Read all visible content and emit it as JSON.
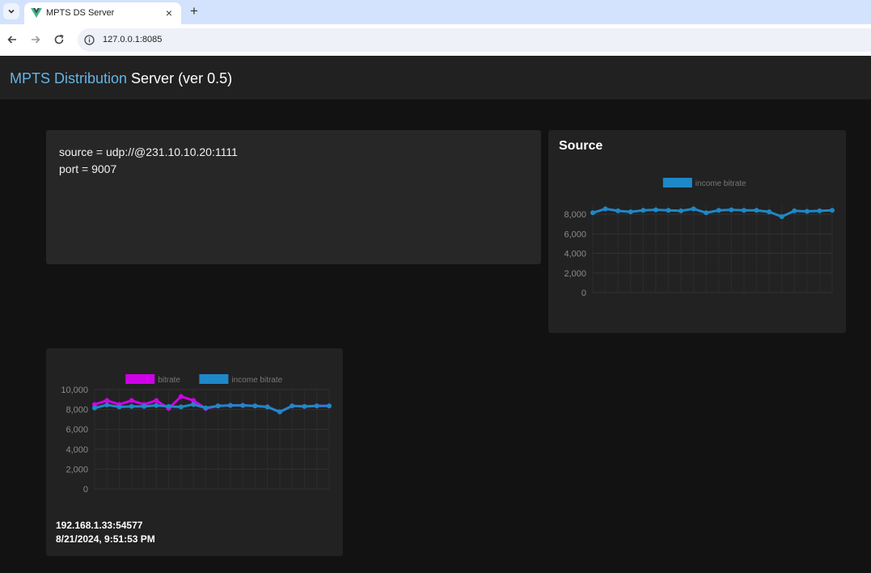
{
  "browser": {
    "tab_title": "MPTS DS Server",
    "url": "127.0.0.1:8085"
  },
  "app": {
    "title_accent": "MPTS Distribution",
    "title_rest": " Server (ver 0.5)"
  },
  "info": {
    "source_line": "source = udp://@231.10.10.20:1111",
    "port_line": "port = 9007"
  },
  "source_card": {
    "title": "Source"
  },
  "client_card": {
    "address": "192.168.1.33:54577",
    "timestamp": "8/21/2024, 9:51:53 PM"
  },
  "colors": {
    "income": "#1e88c8",
    "bitrate": "#d000e8",
    "accent": "#64b5e6"
  },
  "chart_data": [
    {
      "type": "line",
      "legend": "top",
      "grid": true,
      "ylim": [
        0,
        9000
      ],
      "yticks": [
        0,
        2000,
        4000,
        6000,
        8000
      ],
      "ytick_labels": [
        "0",
        "2,000",
        "4,000",
        "6,000",
        "8,000"
      ],
      "series": [
        {
          "name": "income bitrate",
          "color": "#1e88c8",
          "values": [
            8150,
            8550,
            8350,
            8250,
            8400,
            8450,
            8400,
            8350,
            8550,
            8150,
            8400,
            8450,
            8400,
            8400,
            8250,
            7750,
            8350,
            8300,
            8350,
            8400
          ]
        }
      ]
    },
    {
      "type": "line",
      "legend": "top",
      "grid": true,
      "ylim": [
        0,
        10000
      ],
      "yticks": [
        0,
        2000,
        4000,
        6000,
        8000,
        10000
      ],
      "ytick_labels": [
        "0",
        "2,000",
        "4,000",
        "6,000",
        "8,000",
        "10,000"
      ],
      "series": [
        {
          "name": "bitrate",
          "color": "#d000e8",
          "values": [
            8500,
            8900,
            8500,
            8900,
            8500,
            8900,
            8100,
            9300,
            8900,
            8100,
            8350,
            8400,
            8400,
            8350,
            8250,
            7750,
            8350,
            8300,
            8350,
            8350
          ]
        },
        {
          "name": "income bitrate",
          "color": "#1e88c8",
          "values": [
            8150,
            8450,
            8250,
            8300,
            8300,
            8400,
            8300,
            8250,
            8500,
            8150,
            8350,
            8400,
            8400,
            8350,
            8250,
            7750,
            8350,
            8300,
            8350,
            8350
          ]
        }
      ]
    }
  ]
}
